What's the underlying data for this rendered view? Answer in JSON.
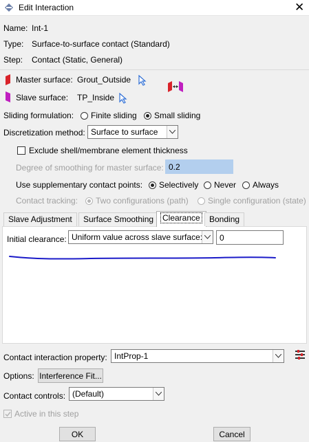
{
  "window": {
    "title": "Edit Interaction"
  },
  "info": {
    "name_label": "Name:",
    "name_value": "Int-1",
    "type_label": "Type:",
    "type_value": "Surface-to-surface contact (Standard)",
    "step_label": "Step:",
    "step_value": "Contact (Static, General)"
  },
  "surfaces": {
    "master_label": "Master surface:",
    "master_value": "Grout_Outside",
    "slave_label": "Slave surface:",
    "slave_value": "TP_Inside"
  },
  "sliding": {
    "label": "Sliding formulation:",
    "finite": "Finite sliding",
    "small": "Small sliding"
  },
  "discretization": {
    "label": "Discretization method:",
    "value": "Surface to surface"
  },
  "exclude_shell": {
    "label": "Exclude shell/membrane element thickness"
  },
  "smoothing": {
    "label": "Degree of smoothing for master surface:",
    "value": "0.2"
  },
  "supplementary": {
    "label": "Use supplementary contact points:",
    "selectively": "Selectively",
    "never": "Never",
    "always": "Always"
  },
  "tracking": {
    "label": "Contact tracking:",
    "two": "Two configurations (path)",
    "single": "Single configuration (state)"
  },
  "tabs": [
    {
      "label": "Slave Adjustment"
    },
    {
      "label": "Surface Smoothing"
    },
    {
      "label": "Clearance"
    },
    {
      "label": "Bonding"
    }
  ],
  "clearance": {
    "label": "Initial clearance:",
    "method_value": "Uniform value across slave surface:",
    "value": "0"
  },
  "property": {
    "label": "Contact interaction property:",
    "value": "IntProp-1"
  },
  "options": {
    "label": "Options:",
    "button": "Interference Fit..."
  },
  "controls": {
    "label": "Contact controls:",
    "value": "(Default)"
  },
  "active": {
    "label": "Active in this step"
  },
  "buttons": {
    "ok": "OK",
    "cancel": "Cancel"
  },
  "colors": {
    "annotation_stroke": "#1a1ac8",
    "field_highlight": "#b3cfee"
  },
  "icons": [
    "interaction-icon",
    "close-icon",
    "select-arrow-icon",
    "swap-surfaces-icon",
    "property-manager-icon"
  ]
}
